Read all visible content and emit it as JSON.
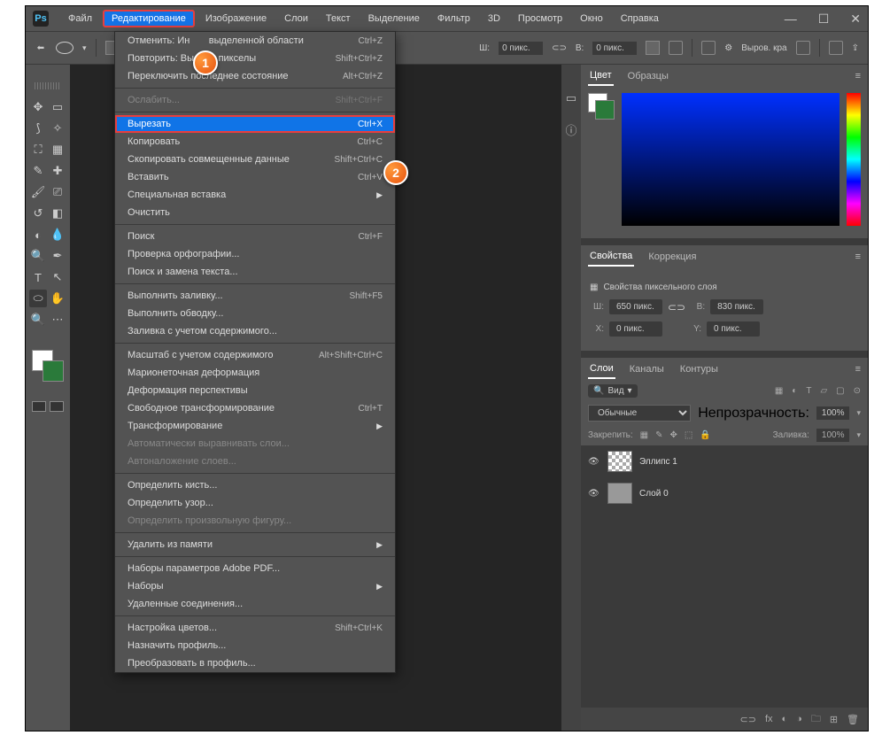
{
  "menubar": {
    "items": [
      "Файл",
      "Редактирование",
      "Изображение",
      "Слои",
      "Текст",
      "Выделение",
      "Фильтр",
      "3D",
      "Просмотр",
      "Окно",
      "Справка"
    ]
  },
  "optbar": {
    "w_label": "Ш:",
    "w_val": "0 пикс.",
    "h_label": "В:",
    "h_val": "0 пикс.",
    "align": "Выров. кра"
  },
  "dropdown": {
    "undo": "Отменить: Ин",
    "undo_rest": "выделенной области",
    "undo_sc": "Ctrl+Z",
    "redo": "Повторить: Вы",
    "redo_rest": "пикселы",
    "redo_sc": "Shift+Ctrl+Z",
    "toggle": "Переключить последнее состояние",
    "toggle_sc": "Alt+Ctrl+Z",
    "fade": "Ослабить...",
    "fade_sc": "Shift+Ctrl+F",
    "cut": "Вырезать",
    "cut_sc": "Ctrl+X",
    "copy": "Копировать",
    "copy_sc": "Ctrl+C",
    "copymerged": "Скопировать совмещенные данные",
    "copymerged_sc": "Shift+Ctrl+C",
    "paste": "Вставить",
    "paste_sc": "Ctrl+V",
    "pastesp": "Специальная вставка",
    "clear": "Очистить",
    "search": "Поиск",
    "search_sc": "Ctrl+F",
    "spell": "Проверка орфографии...",
    "findrep": "Поиск и замена текста...",
    "fill": "Выполнить заливку...",
    "fill_sc": "Shift+F5",
    "stroke": "Выполнить обводку...",
    "contentfill": "Заливка с учетом содержимого...",
    "contentscale": "Масштаб с учетом содержимого",
    "contentscale_sc": "Alt+Shift+Ctrl+C",
    "puppet": "Марионеточная деформация",
    "persp": "Деформация перспективы",
    "freetrans": "Свободное трансформирование",
    "freetrans_sc": "Ctrl+T",
    "trans": "Трансформирование",
    "autoalign": "Автоматически выравнивать слои...",
    "autoblend": "Автоналожение слоев...",
    "brush": "Определить кисть...",
    "pattern": "Определить узор...",
    "shape": "Определить произвольную фигуру...",
    "purge": "Удалить из памяти",
    "pdf": "Наборы параметров Adobe PDF...",
    "presets": "Наборы",
    "remote": "Удаленные соединения...",
    "color": "Настройка цветов...",
    "color_sc": "Shift+Ctrl+K",
    "assign": "Назначить профиль...",
    "convert": "Преобразовать в профиль..."
  },
  "panels": {
    "color": "Цвет",
    "swatches": "Образцы",
    "properties": "Свойства",
    "adjustments": "Коррекция",
    "pixel_props": "Свойства пиксельного слоя",
    "w_label": "Ш:",
    "w_val": "650 пикс.",
    "h_label": "В:",
    "h_val": "830 пикс.",
    "x_label": "X:",
    "x_val": "0 пикс.",
    "y_label": "Y:",
    "y_val": "0 пикс.",
    "layers": "Слои",
    "channels": "Каналы",
    "paths": "Контуры",
    "kind": "Вид",
    "blend": "Обычные",
    "opacity_label": "Непрозрачность:",
    "opacity": "100%",
    "lock_label": "Закрепить:",
    "fill_label": "Заливка:",
    "fill": "100%",
    "layer1": "Эллипс 1",
    "layer2": "Слой 0"
  }
}
